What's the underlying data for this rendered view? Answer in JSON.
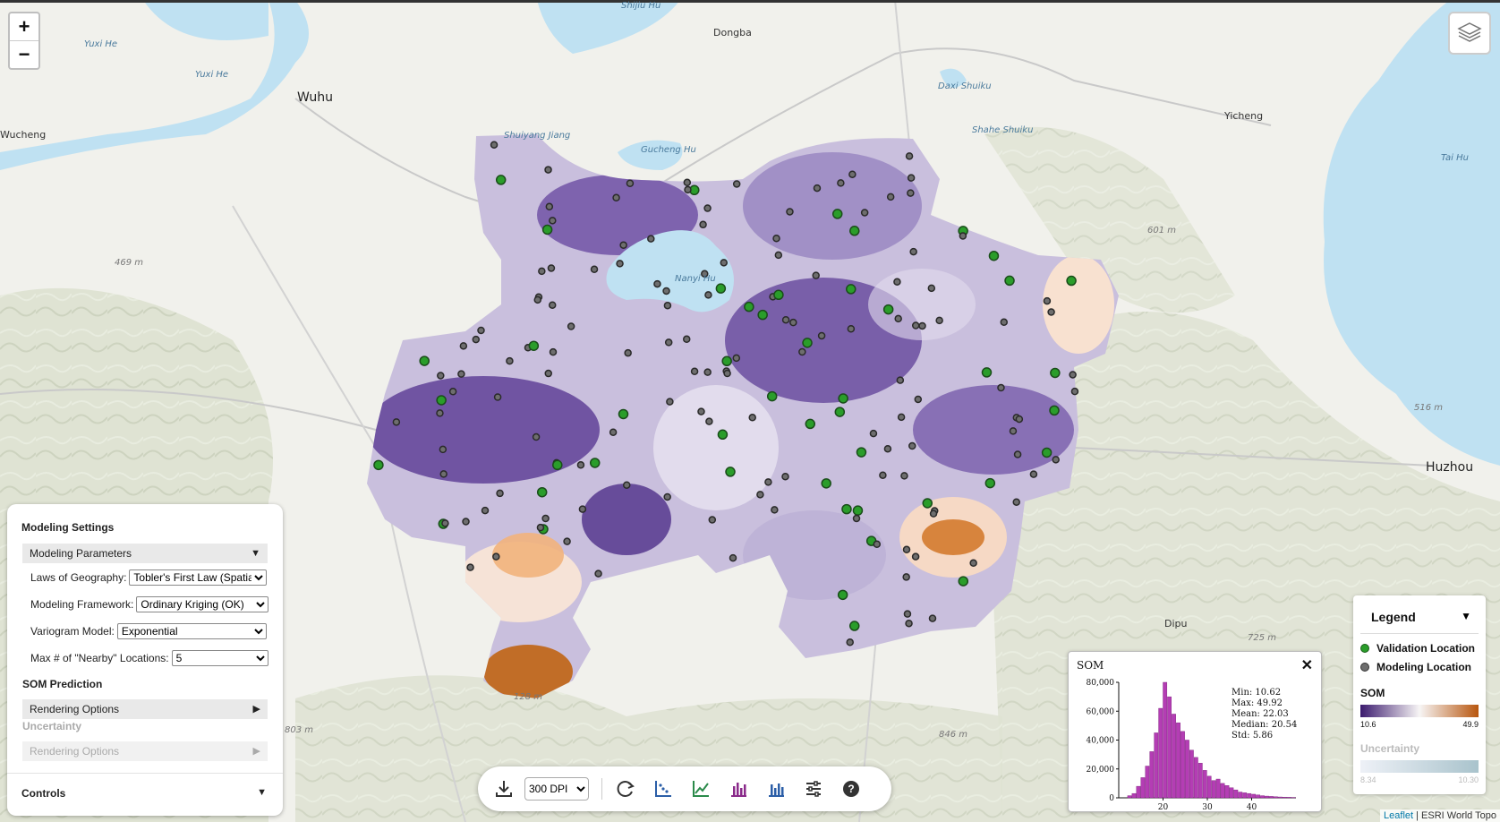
{
  "map": {
    "places": [
      {
        "name": "Wuhu",
        "cls": "big",
        "x": 332,
        "y": 101
      },
      {
        "name": "Dongba",
        "cls": "",
        "x": 797,
        "y": 30
      },
      {
        "name": "Shijiu Hu",
        "cls": "water",
        "x": 694,
        "y": 1
      },
      {
        "name": "Yuxi He",
        "cls": "water",
        "x": 94,
        "y": 44
      },
      {
        "name": "Yuxi He",
        "cls": "water",
        "x": 218,
        "y": 78
      },
      {
        "name": "Wucheng",
        "cls": "",
        "x": 0,
        "y": 144
      },
      {
        "name": "Gucheng Hu",
        "cls": "water",
        "x": 716,
        "y": 162
      },
      {
        "name": "Shuiyang Jiang",
        "cls": "water",
        "x": 563,
        "y": 146
      },
      {
        "name": "Daxi Shuiku",
        "cls": "water",
        "x": 1048,
        "y": 91
      },
      {
        "name": "Shahe Shuiku",
        "cls": "water",
        "x": 1086,
        "y": 140
      },
      {
        "name": "Yicheng",
        "cls": "",
        "x": 1368,
        "y": 123
      },
      {
        "name": "Tai Hu",
        "cls": "water",
        "x": 1610,
        "y": 171
      },
      {
        "name": "Nanyi Hu",
        "cls": "water",
        "x": 754,
        "y": 306
      },
      {
        "name": "469 m",
        "cls": "elev",
        "x": 128,
        "y": 288
      },
      {
        "name": "601 m",
        "cls": "elev",
        "x": 1282,
        "y": 252
      },
      {
        "name": "516 m",
        "cls": "elev",
        "x": 1580,
        "y": 450
      },
      {
        "name": "Huzhou",
        "cls": "big",
        "x": 1593,
        "y": 514
      },
      {
        "name": "Dipu",
        "cls": "",
        "x": 1301,
        "y": 690
      },
      {
        "name": "725 m",
        "cls": "elev",
        "x": 1394,
        "y": 707
      },
      {
        "name": "846 m",
        "cls": "elev",
        "x": 1049,
        "y": 815
      },
      {
        "name": "803 m",
        "cls": "elev",
        "x": 318,
        "y": 810
      },
      {
        "name": "128 m",
        "cls": "elev",
        "x": 574,
        "y": 773
      }
    ],
    "zoom_in": "+",
    "zoom_out": "−"
  },
  "modeling_panel": {
    "title": "Modeling Settings",
    "params_header": "Modeling Parameters",
    "laws_label": "Laws of Geography:",
    "laws_value": "Tobler's First Law (Spatial",
    "framework_label": "Modeling Framework:",
    "framework_value": "Ordinary Kriging (OK)",
    "variogram_label": "Variogram Model:",
    "variogram_value": "Exponential",
    "max_label": "Max # of \"Nearby\" Locations:",
    "max_value": "5",
    "som_section": "SOM Prediction",
    "rendering_options": "Rendering Options",
    "uncertainty_section": "Uncertainty",
    "rendering_options_disabled": "Rendering Options",
    "controls": "Controls",
    "arrow_down": "▼",
    "arrow_right": "▶"
  },
  "toolbar": {
    "dpi_value": "300 DPI",
    "icons": [
      "download-icon",
      "refresh-icon",
      "scatter-plot-icon",
      "line-chart-icon",
      "bar-chart-icon",
      "histogram-icon",
      "sliders-icon",
      "help-icon"
    ]
  },
  "histogram": {
    "title": "SOM",
    "close": "✕",
    "stats": {
      "min": "Min: 10.62",
      "max": "Max: 49.92",
      "mean": "Mean: 22.03",
      "median": "Median: 20.54",
      "std": "Std: 5.86"
    }
  },
  "chart_data": {
    "type": "bar",
    "title": "SOM",
    "xlabel": "",
    "ylabel": "",
    "x_ticks": [
      20,
      30,
      40
    ],
    "y_ticks": [
      "0",
      "20,000",
      "40,000",
      "60,000",
      "80,000"
    ],
    "xlim": [
      10.6,
      49.9
    ],
    "ylim": [
      0,
      80000
    ],
    "bin_start": 12,
    "bin_width": 1,
    "values": [
      1500,
      3000,
      8000,
      14000,
      22000,
      32000,
      45000,
      62000,
      80000,
      70000,
      58000,
      52000,
      46000,
      40000,
      33000,
      28000,
      24000,
      19000,
      15000,
      12000,
      13000,
      10000,
      8500,
      7000,
      5500,
      4000,
      3500,
      3000,
      2500,
      2000,
      1500,
      1200,
      1000,
      800,
      600,
      500,
      400,
      300
    ]
  },
  "legend": {
    "title": "Legend",
    "arrow": "▼",
    "validation": "Validation Location",
    "modeling": "Modeling Location",
    "som_label": "SOM",
    "som_min": "10.6",
    "som_max": "49.9",
    "unc_label": "Uncertainty",
    "unc_min": "8.34",
    "unc_max": "10.30",
    "colors": {
      "validation": "#2a9d2a",
      "modeling": "#6e6e6e",
      "som_low": "#3b1a6e",
      "som_mid": "#f7f5f5",
      "som_high": "#b8560e",
      "unc_low": "#eef1f7",
      "unc_high": "#a9c3cc"
    }
  },
  "attribution": {
    "leaflet": "Leaflet",
    "rest": " | ESRI World Topo"
  }
}
